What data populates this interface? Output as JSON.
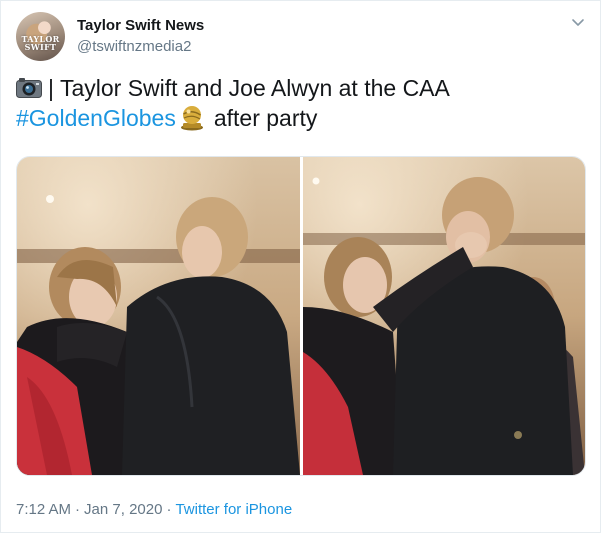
{
  "author": {
    "display_name": "Taylor Swift News",
    "handle": "@tswiftnzmedia2",
    "avatar_text_top": "TAYLOR",
    "avatar_text_bottom": "SWIFT"
  },
  "tweet": {
    "text_line1": " | Taylor Swift and Joe Alwyn at the CAA",
    "hashtag": "#GoldenGlobes",
    "text_after_hashtag": "after party",
    "camera_icon": "camera-emoji",
    "globe_icon": "golden-globe-emoji"
  },
  "media": {
    "photo_count": 2
  },
  "footer": {
    "time": "7:12 AM",
    "separator": "·",
    "date": "Jan 7, 2020",
    "source": "Twitter for iPhone"
  },
  "colors": {
    "link": "#1b95e0",
    "text": "#14171a",
    "muted": "#657786",
    "border": "#e6ecf0"
  }
}
